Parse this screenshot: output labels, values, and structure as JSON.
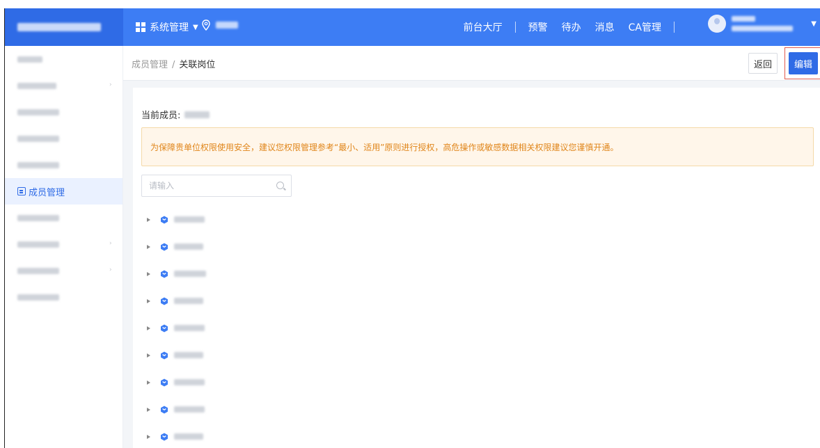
{
  "header": {
    "menu_label": "系统管理",
    "nav_items": [
      "前台大厅",
      "预警",
      "待办",
      "消息",
      "CA管理"
    ]
  },
  "sidebar": {
    "items": [
      {
        "label": "",
        "icon": "home-icon",
        "has_arrow": false
      },
      {
        "label": "",
        "icon": "ca-icon",
        "has_arrow": true
      },
      {
        "label": "",
        "icon": "org-icon",
        "has_arrow": false
      },
      {
        "label": "",
        "icon": "user-icon",
        "has_arrow": false
      },
      {
        "label": "",
        "icon": "role-icon",
        "has_arrow": false
      },
      {
        "label": "成员管理",
        "icon": "member-icon",
        "has_arrow": false,
        "active": true
      },
      {
        "label": "",
        "icon": "audit-icon",
        "has_arrow": false
      },
      {
        "label": "",
        "icon": "settings-icon",
        "has_arrow": true
      },
      {
        "label": "",
        "icon": "security-icon",
        "has_arrow": true
      },
      {
        "label": "",
        "icon": "log-icon",
        "has_arrow": false
      }
    ]
  },
  "breadcrumb": {
    "parent": "成员管理",
    "current": "关联岗位"
  },
  "actions": {
    "back_label": "返回",
    "edit_label": "编辑"
  },
  "main": {
    "member_label": "当前成员:",
    "notice": "为保障贵单位权限使用安全，建议您权限管理参考“最小、适用”原则进行授权，高危操作或敏感数据相关权限建议您谨慎开通。",
    "search_placeholder": "请输入",
    "tree_node_count": 9
  },
  "colors": {
    "primary": "#3d7df4",
    "highlight_border": "#e05a4f",
    "notice_text": "#e0861b",
    "notice_bg": "#fff6ea"
  }
}
